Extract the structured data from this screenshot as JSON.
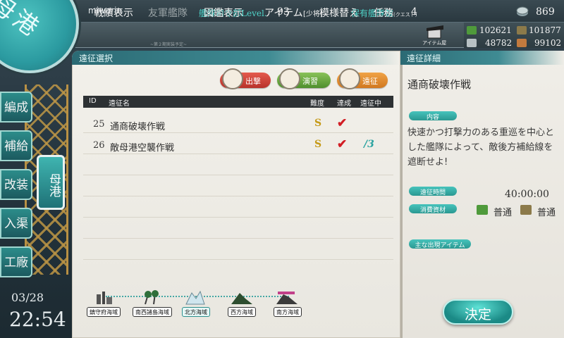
{
  "header": {
    "username": "miwarin",
    "level_label": "艦隊司令部Level.",
    "level": "93",
    "rank": "[少将]",
    "ships_label": "保有艦隊数",
    "ships": "4",
    "coins": "869"
  },
  "menu": {
    "items": [
      "戦績表示",
      "友軍艦隊",
      "図鑑表示",
      "アイテム",
      "模様替え",
      "任務"
    ],
    "quest_sub": "(クエスト)",
    "ally_sub": "~第２期実装予定~",
    "item_shop": "アイテム屋"
  },
  "resources": {
    "fuel": "102621",
    "ammo": "101877",
    "steel": "48782",
    "bauxite": "99102"
  },
  "badge": "母港",
  "sidenav": [
    "編成",
    "補給",
    "改装",
    "入渠",
    "工廠"
  ],
  "sidenav_active": "母港",
  "datetime": {
    "date": "03/28",
    "time": "22:54"
  },
  "list_panel": {
    "title": "遠征選択",
    "tabs": [
      "出撃",
      "演習",
      "遠征"
    ],
    "columns": [
      "ID",
      "遠征名",
      "難度",
      "達成",
      "遠征中"
    ],
    "rows": [
      {
        "id": "25",
        "name": "通商破壊作戦",
        "difficulty": "S",
        "achieved": "✔",
        "going": ""
      },
      {
        "id": "26",
        "name": "敵母港空襲作戦",
        "difficulty": "S",
        "achieved": "✔",
        "going": "/3"
      }
    ]
  },
  "maps": [
    "鎮守府海域",
    "南西諸島海域",
    "北方海域",
    "西方海域",
    "南方海域"
  ],
  "detail_panel": {
    "title": "遠征詳細",
    "expedition_name": "通商破壊作戦",
    "content_label": "内容",
    "description": "快速かつ打撃力のある重巡を中心とした艦隊によって、敵後方補給線を遮断せよ!",
    "time_label": "遠征時間",
    "time": "40:00:00",
    "cost_label": "消費資材",
    "fuel_cost": "普通",
    "ammo_cost": "普通",
    "items_label": "主な出現アイテム",
    "decide": "決定"
  }
}
